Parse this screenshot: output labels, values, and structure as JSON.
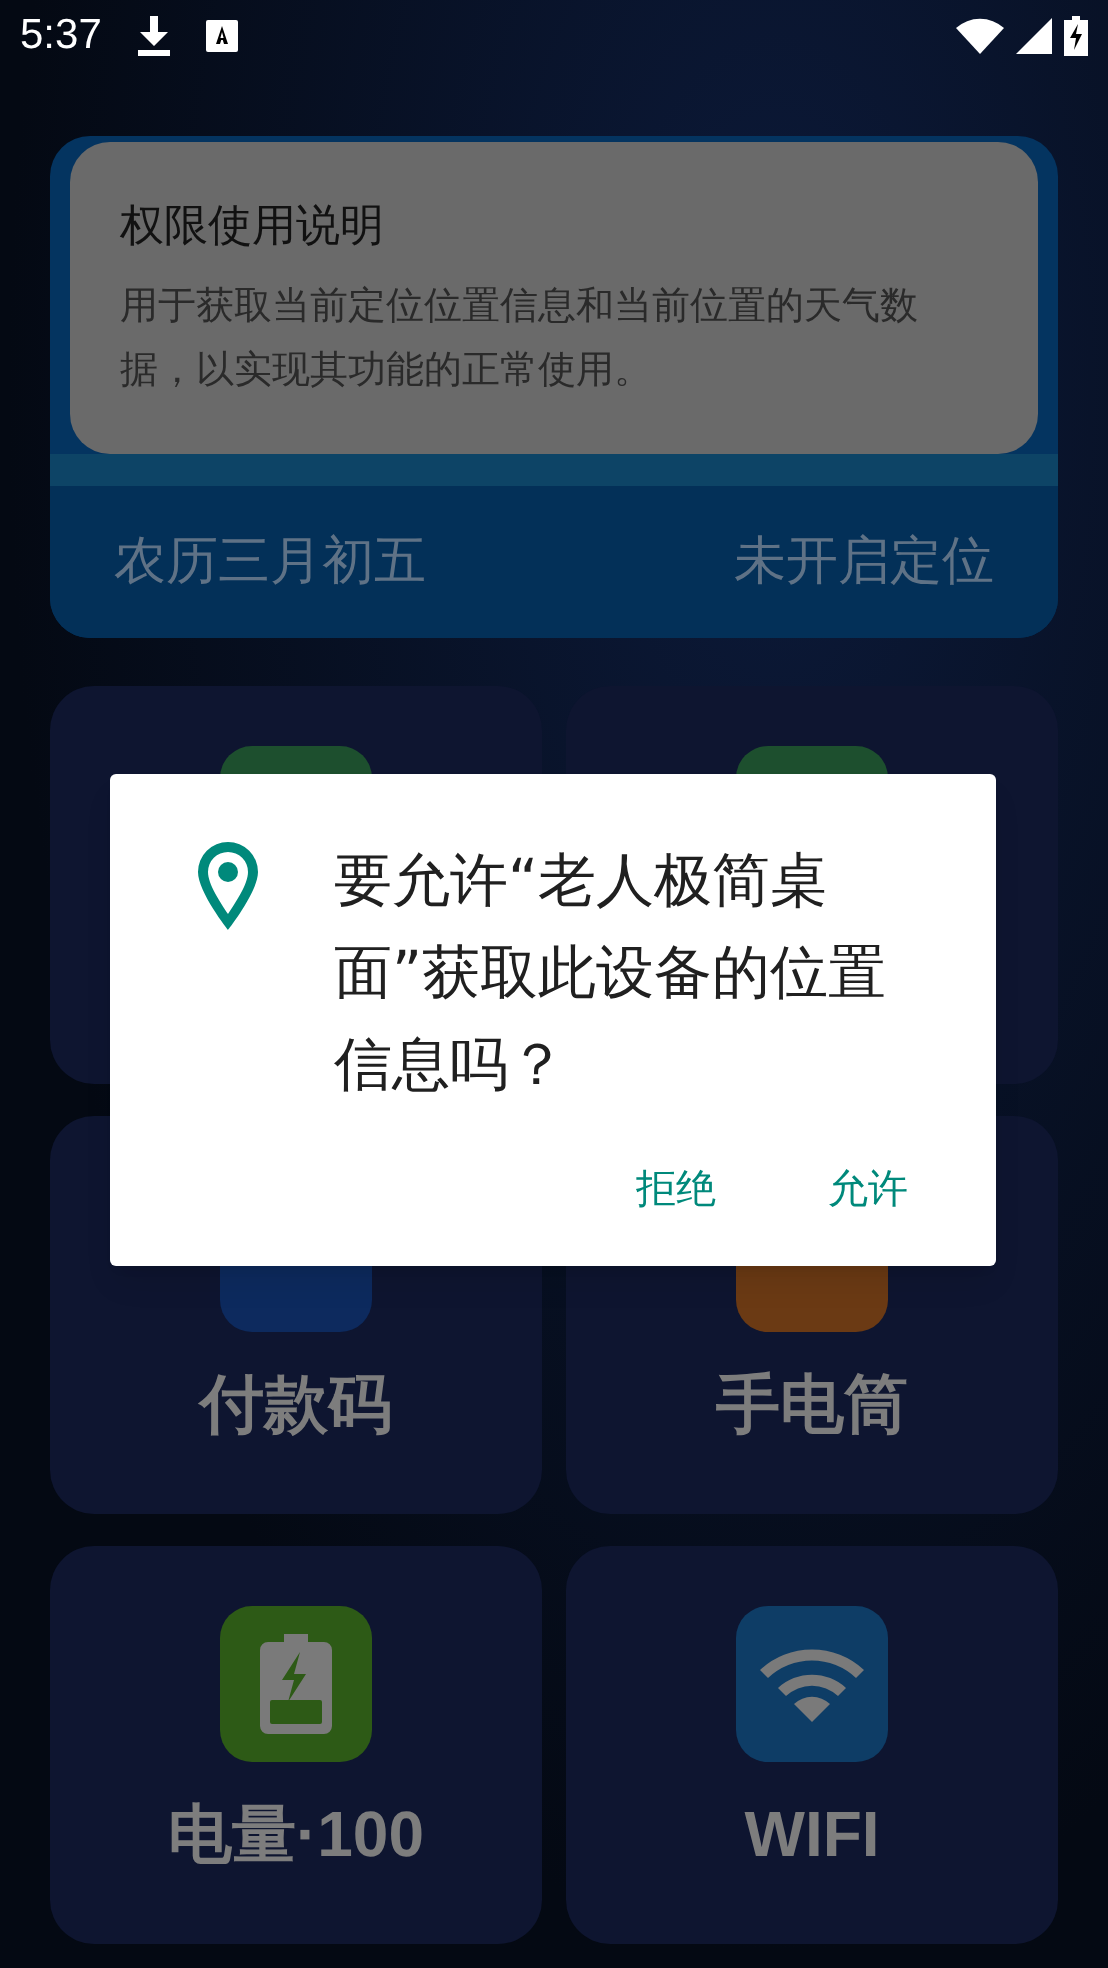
{
  "status_bar": {
    "time": "5:37"
  },
  "info_card": {
    "title": "权限使用说明",
    "body": "用于获取当前定位位置信息和当前位置的天气数据，以实现其功能的正常使用。"
  },
  "date_bar": {
    "lunar_date": "农历三月初五",
    "location_status": "未开启定位"
  },
  "tiles": [
    {
      "kind": "hidden",
      "color": "#1d4f2e"
    },
    {
      "kind": "hidden",
      "color": "#1d4f2e"
    },
    {
      "kind": "payment",
      "label": "付款码",
      "color": "#0d2a5e"
    },
    {
      "kind": "flashlight",
      "label": "手电筒",
      "color": "#6b3a14"
    },
    {
      "kind": "battery",
      "label": "电量·100",
      "color": "#2d5a16"
    },
    {
      "kind": "wifi",
      "label": "WIFI",
      "color": "#0e3d66"
    }
  ],
  "dialog": {
    "message": "要允许“老人极简桌面”获取此设备的位置信息吗？",
    "buttons": [
      "拒绝",
      "允许"
    ]
  }
}
